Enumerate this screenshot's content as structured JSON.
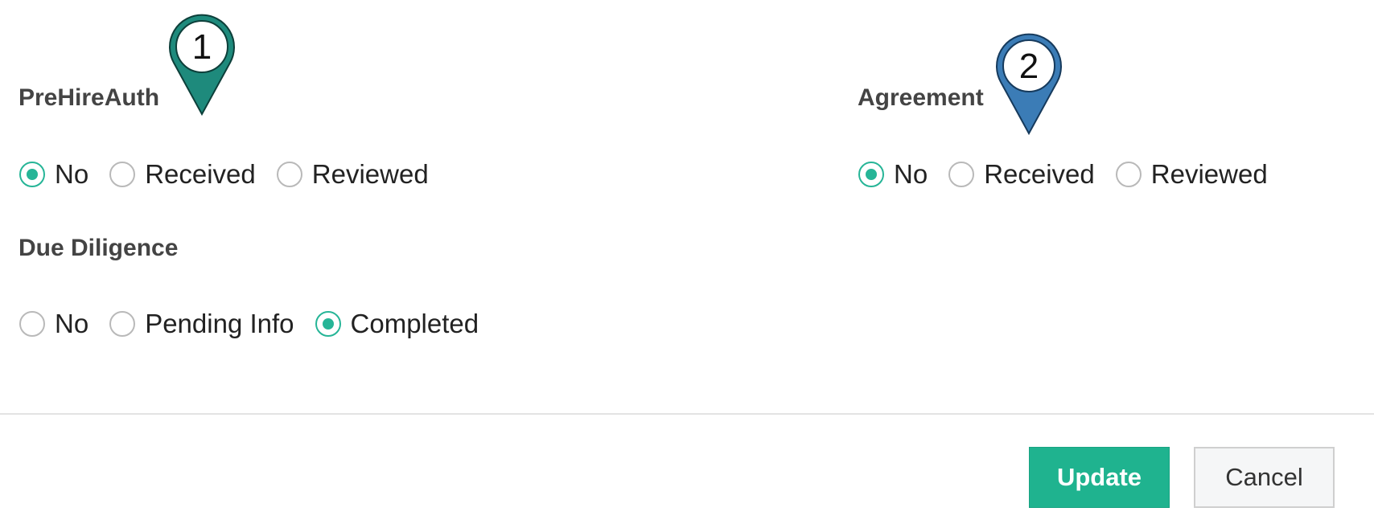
{
  "fields": {
    "prehire": {
      "label": "PreHireAuth",
      "options": [
        "No",
        "Received",
        "Reviewed"
      ],
      "selected": "No"
    },
    "agreement": {
      "label": "Agreement",
      "options": [
        "No",
        "Received",
        "Reviewed"
      ],
      "selected": "No"
    },
    "due_diligence": {
      "label": "Due Diligence",
      "options": [
        "No",
        "Pending Info",
        "Completed"
      ],
      "selected": "Completed"
    }
  },
  "buttons": {
    "update_label": "Update",
    "cancel_label": "Cancel"
  },
  "markers": [
    {
      "number": "1",
      "color": "#1e8a7c",
      "icon": "map-pin-icon"
    },
    {
      "number": "2",
      "color": "#3b7cb6",
      "icon": "map-pin-icon"
    }
  ],
  "colors": {
    "accent": "#26b597",
    "primary_button": "#1fb38f"
  }
}
